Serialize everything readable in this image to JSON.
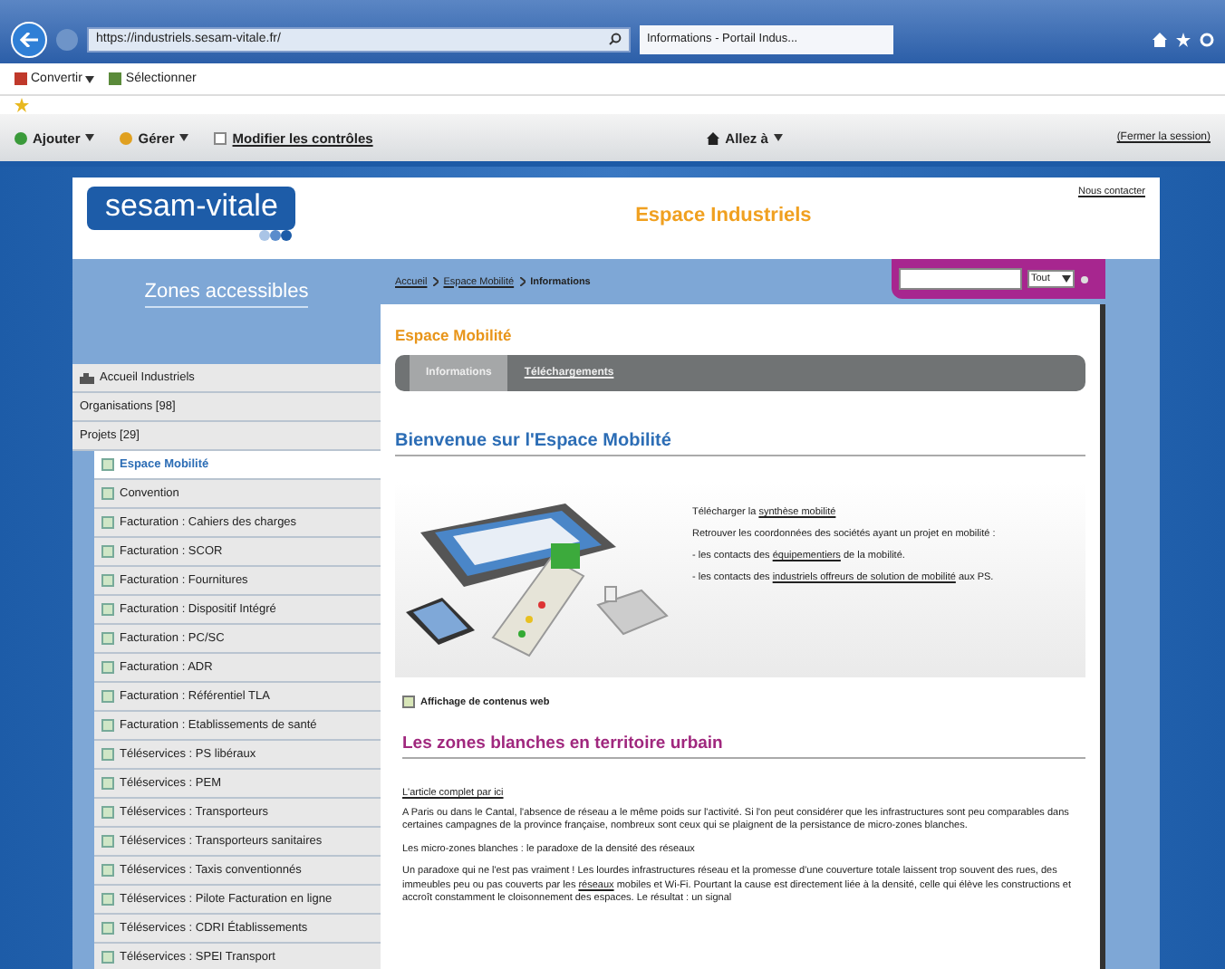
{
  "browser": {
    "url": "https://industriels.sesam-vitale.fr/",
    "tab_title": "Informations - Portail Indus..."
  },
  "command_bar": [
    "Convertir",
    "Sélectionner"
  ],
  "site_toolbar": {
    "actions": [
      "Ajouter",
      "Gérer"
    ],
    "edit_link": "Modifier les contrôles",
    "goto": "Allez à",
    "logout": "(Fermer la session)"
  },
  "header": {
    "logo": "sesam-vitale",
    "title": "Espace Industriels",
    "contact": "Nous contacter"
  },
  "sidebar": {
    "title": "Zones accessibles",
    "items": [
      {
        "label": "Accueil Industriels",
        "selected": false,
        "kind": "home"
      },
      {
        "label": "Organisations [98]",
        "selected": false,
        "kind": "plain"
      },
      {
        "label": "Projets [29]",
        "selected": false,
        "kind": "plain",
        "children": [
          {
            "label": "Espace Mobilité",
            "selected": true
          },
          {
            "label": "Convention",
            "selected": false
          },
          {
            "label": "Facturation : Cahiers des charges",
            "selected": false
          },
          {
            "label": "Facturation : SCOR",
            "selected": false
          },
          {
            "label": "Facturation : Fournitures",
            "selected": false
          },
          {
            "label": "Facturation : Dispositif Intégré",
            "selected": false
          },
          {
            "label": "Facturation : PC/SC",
            "selected": false
          },
          {
            "label": "Facturation : ADR",
            "selected": false
          },
          {
            "label": "Facturation : Référentiel TLA",
            "selected": false
          },
          {
            "label": "Facturation : Etablissements de santé",
            "selected": false
          },
          {
            "label": "Téléservices : PS libéraux",
            "selected": false
          },
          {
            "label": "Téléservices : PEM",
            "selected": false
          },
          {
            "label": "Téléservices : Transporteurs",
            "selected": false
          },
          {
            "label": "Téléservices : Transporteurs sanitaires",
            "selected": false
          },
          {
            "label": "Téléservices : Taxis conventionnés",
            "selected": false
          },
          {
            "label": "Téléservices : Pilote Facturation en ligne",
            "selected": false
          },
          {
            "label": "Téléservices : CDRI Établissements",
            "selected": false
          },
          {
            "label": "Téléservices : SPEI Transport",
            "selected": false
          }
        ]
      }
    ]
  },
  "breadcrumb": [
    "Accueil",
    "Espace Mobilité",
    "Informations"
  ],
  "search": {
    "scope": "Tout"
  },
  "content": {
    "section_title": "Espace Mobilité",
    "tabs": [
      {
        "label": "Informations",
        "selected": true
      },
      {
        "label": "Téléchargements",
        "selected": false
      }
    ],
    "welcome_title": "Bienvenue sur l'Espace Mobilité",
    "promo_lines": [
      [
        {
          "text": "Télécharger la ",
          "link": false
        },
        {
          "text": "synthèse mobilité",
          "link": true
        }
      ],
      [
        {
          "text": "Retrouver les coordonnées des sociétés ayant un projet en mobilité :",
          "link": false
        }
      ],
      [
        {
          "text": "- les contacts des ",
          "link": false
        },
        {
          "text": "équipementiers",
          "link": true
        },
        {
          "text": " de la mobilité.",
          "link": false
        }
      ],
      [
        {
          "text": "- les contacts des ",
          "link": false
        },
        {
          "text": "industriels offreurs de solution de mobilité",
          "link": true
        },
        {
          "text": " aux PS.",
          "link": false
        }
      ]
    ],
    "web_part_label": "Affichage de contenus web",
    "article_title": "Les zones blanches en territoire urbain",
    "article_link": "L'article complet par ici",
    "paragraphs": [
      [
        {
          "text": "A Paris ou dans le Cantal, l'absence de réseau a le même poids sur l'activité. Si l'on peut considérer que les infrastructures sont peu comparables dans certaines campagnes de la province française, nombreux sont ceux qui se plaignent de la persistance de micro-zones blanches.",
          "link": false
        }
      ],
      [
        {
          "text": "Les micro-zones blanches : le paradoxe de la densité des réseaux",
          "link": false
        }
      ],
      [
        {
          "text": "Un paradoxe qui ne l'est pas vraiment ! Les lourdes infrastructures réseau et la promesse d'une couverture totale laissent trop souvent des rues, des immeubles peu ou pas couverts par les ",
          "link": false
        },
        {
          "text": "réseaux",
          "link": true
        },
        {
          "text": " mobiles et Wi-Fi. Pourtant la cause est directement liée à la densité, celle qui élève les constructions et accroît constamment le cloisonnement des espaces. Le résultat : un signal",
          "link": false
        }
      ]
    ]
  }
}
